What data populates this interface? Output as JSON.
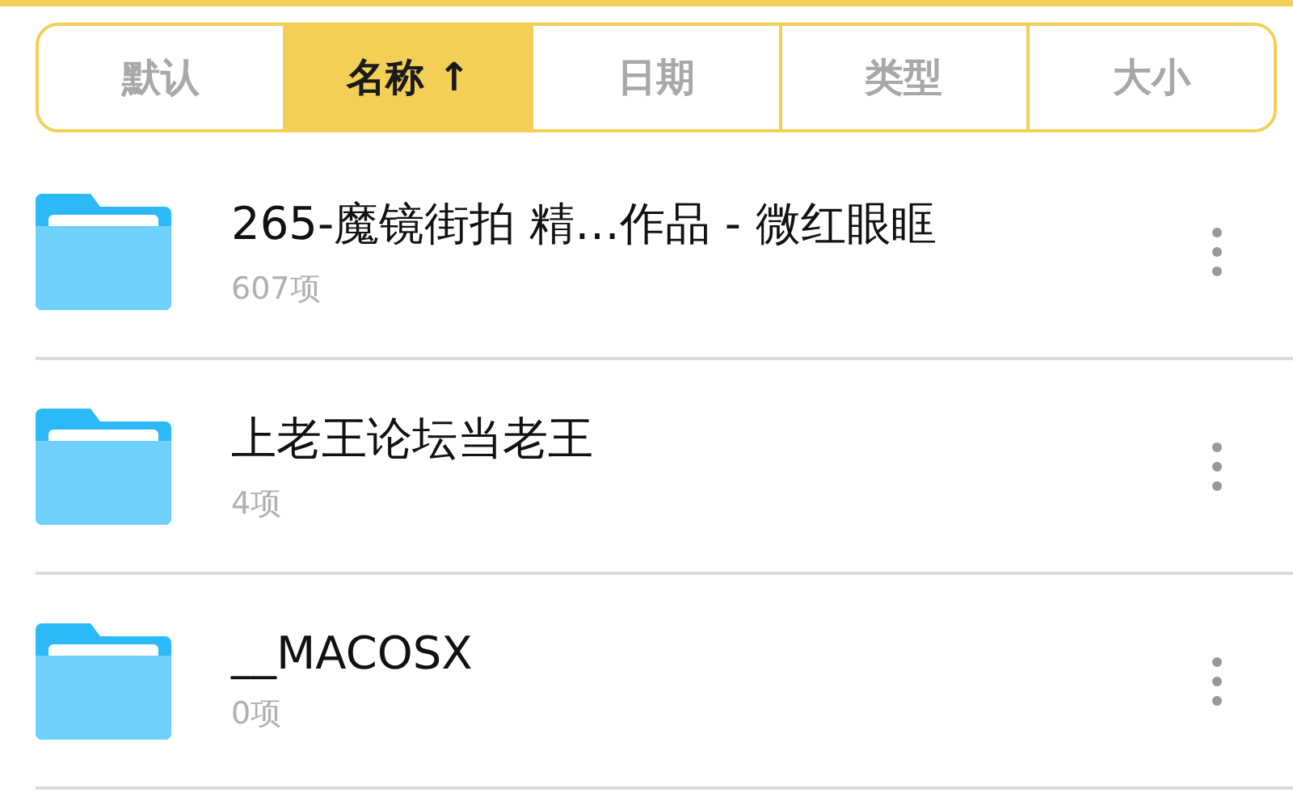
{
  "sort_tabs": [
    {
      "label": "默认",
      "selected": false
    },
    {
      "label": "名称 ↑",
      "selected": true
    },
    {
      "label": "日期",
      "selected": false
    },
    {
      "label": "类型",
      "selected": false
    },
    {
      "label": "大小",
      "selected": false
    }
  ],
  "files": [
    {
      "name": "265-魔镜街拍 精…作品 - 微红眼眶",
      "count": "607项"
    },
    {
      "name": "上老王论坛当老王",
      "count": "4项"
    },
    {
      "name": "__MACOSX",
      "count": "0项"
    }
  ]
}
